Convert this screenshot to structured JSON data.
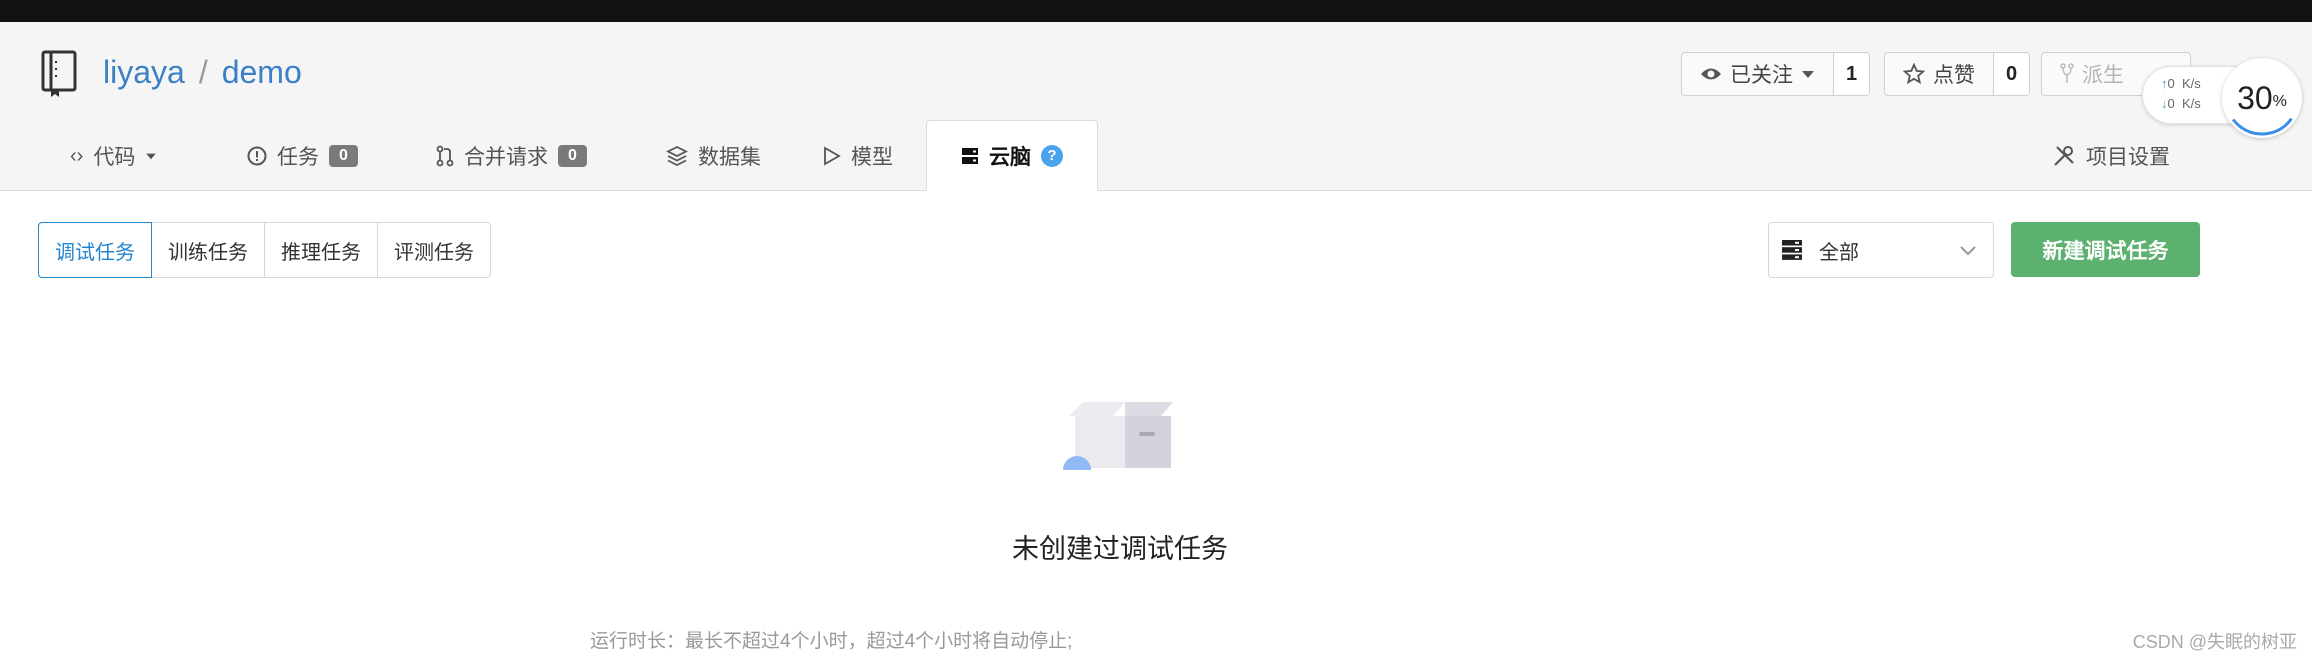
{
  "repo": {
    "owner": "liyaya",
    "separator": "/",
    "name": "demo"
  },
  "actions": {
    "watch_label": "已关注",
    "watch_count": "1",
    "star_label": "点赞",
    "star_count": "0",
    "fork_label": "派生"
  },
  "tabs": [
    {
      "label": "代码",
      "icon": "code-icon"
    },
    {
      "label": "任务",
      "icon": "issue-icon",
      "badge": "0"
    },
    {
      "label": "合并请求",
      "icon": "pull-request-icon",
      "badge": "0"
    },
    {
      "label": "数据集",
      "icon": "dataset-icon"
    },
    {
      "label": "模型",
      "icon": "model-icon"
    },
    {
      "label": "云脑",
      "icon": "cloudbrain-icon",
      "help": "?"
    },
    {
      "label": "项目设置",
      "icon": "settings-icon"
    }
  ],
  "subtabs": [
    "调试任务",
    "训练任务",
    "推理任务",
    "评测任务"
  ],
  "filter": {
    "selected": "全部"
  },
  "new_task_button": "新建调试任务",
  "empty_state": {
    "message": "未创建过调试任务",
    "runtime_note": "运行时长：最长不超过4个小时，超过4个小时将自动停止;"
  },
  "speed_widget": {
    "upload": "0",
    "download": "0",
    "unit": "K/s",
    "percent": "30",
    "percent_sign": "%"
  },
  "watermark": "CSDN @失眠的树亚",
  "colors": {
    "link": "#3b7fc4",
    "primary_green": "#5cb16f",
    "active_blue": "#2185d0"
  }
}
